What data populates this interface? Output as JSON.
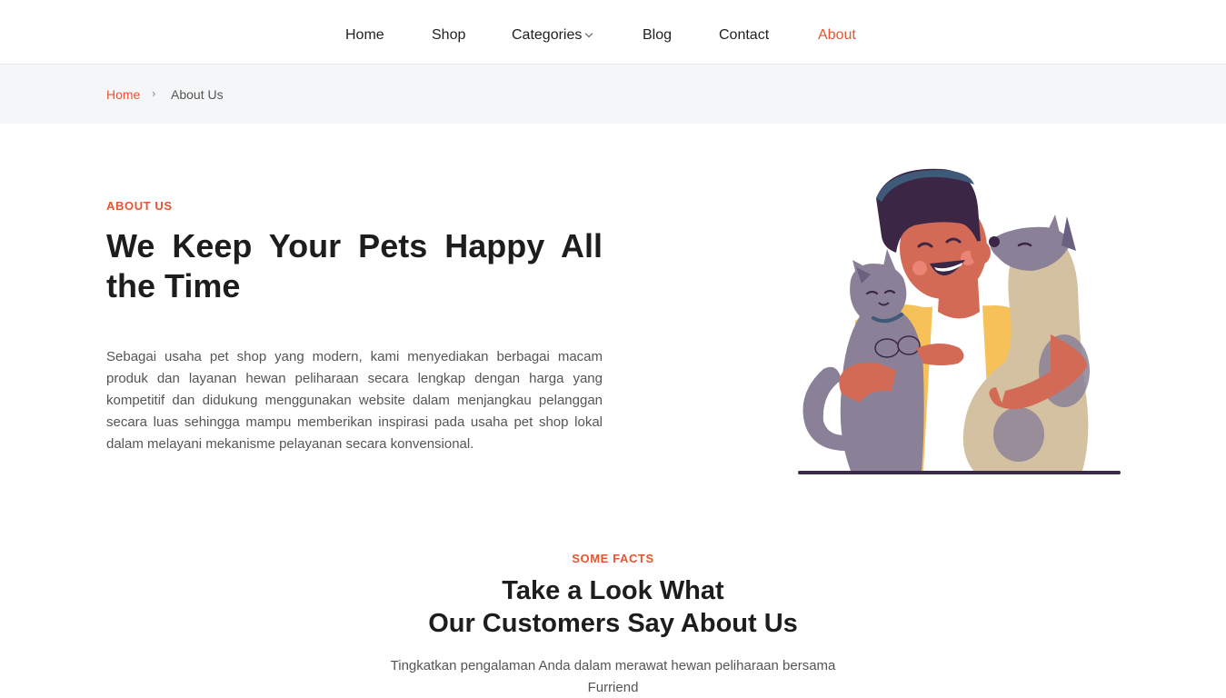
{
  "nav": {
    "items": [
      {
        "label": "Home"
      },
      {
        "label": "Shop"
      },
      {
        "label": "Categories"
      },
      {
        "label": "Blog"
      },
      {
        "label": "Contact"
      },
      {
        "label": "About"
      }
    ],
    "active": "About"
  },
  "breadcrumb": {
    "home": "Home",
    "separator": "›",
    "current": "About Us"
  },
  "about": {
    "eyebrow": "ABOUT US",
    "title": "We Keep Your Pets Happy All the Time",
    "text": "Sebagai usaha pet shop yang modern, kami menyediakan berbagai macam produk dan layanan hewan peliharaan secara lengkap dengan harga yang kompetitif dan didukung menggunakan website dalam menjangkau pelanggan secara luas sehingga mampu memberikan inspirasi pada usaha pet shop lokal dalam melayani mekanisme pelayanan secara konvensional.",
    "illustration": "person-hugging-cat-and-dog-illustration"
  },
  "facts": {
    "eyebrow": "SOME FACTS",
    "title_line1": "Take a Look What",
    "title_line2": "Our Customers Say About Us",
    "subtitle": "Tingkatkan pengalaman Anda dalam merawat hewan peliharaan bersama Furriend"
  },
  "colors": {
    "accent": "#e8542f",
    "heading": "#1d1d1d",
    "body_text": "#555555",
    "breadcrumb_bg": "#f5f6f7"
  }
}
